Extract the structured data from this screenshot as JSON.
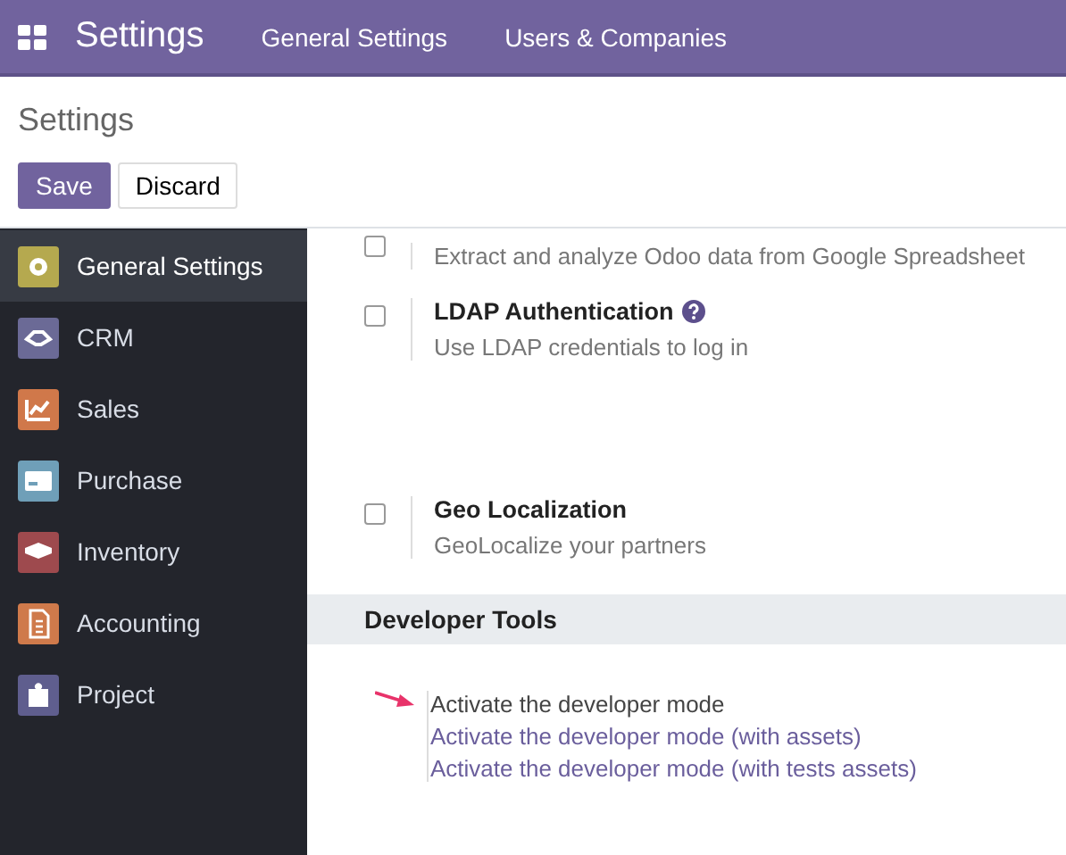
{
  "navbar": {
    "title": "Settings",
    "menus": [
      "General Settings",
      "Users & Companies"
    ]
  },
  "control_panel": {
    "breadcrumb": "Settings",
    "buttons": [
      {
        "label": "Save",
        "kind": "primary"
      },
      {
        "label": "Discard",
        "kind": "secondary"
      }
    ]
  },
  "sidebar": {
    "items": [
      {
        "label": "General Settings",
        "selected": true,
        "color": "#b5a94f",
        "kind": "gear"
      },
      {
        "label": "CRM",
        "selected": false,
        "color": "#6b6a96",
        "kind": "handshake"
      },
      {
        "label": "Sales",
        "selected": false,
        "color": "#d0784a",
        "kind": "chart"
      },
      {
        "label": "Purchase",
        "selected": false,
        "color": "#6f9fb8",
        "kind": "card"
      },
      {
        "label": "Inventory",
        "selected": false,
        "color": "#9e4a4e",
        "kind": "box"
      },
      {
        "label": "Accounting",
        "selected": false,
        "color": "#cf7a4b",
        "kind": "invoice"
      },
      {
        "label": "Project",
        "selected": false,
        "color": "#5f5e8e",
        "kind": "puzzle"
      }
    ]
  },
  "settings": [
    {
      "description": "Extract and analyze Odoo data from Google Spreadsheet",
      "checked": false
    },
    {
      "title": "LDAP Authentication",
      "help": true,
      "description": "Use LDAP credentials to log in",
      "checked": false
    },
    {
      "title": "Geo Localization",
      "help": false,
      "description": "GeoLocalize your partners",
      "checked": false
    }
  ],
  "developer_tools": {
    "heading": "Developer Tools",
    "links": [
      {
        "label": "Activate the developer mode",
        "highlighted": true
      },
      {
        "label": "Activate the developer mode (with assets)",
        "highlighted": false
      },
      {
        "label": "Activate the developer mode (with tests assets)",
        "highlighted": false
      }
    ]
  }
}
